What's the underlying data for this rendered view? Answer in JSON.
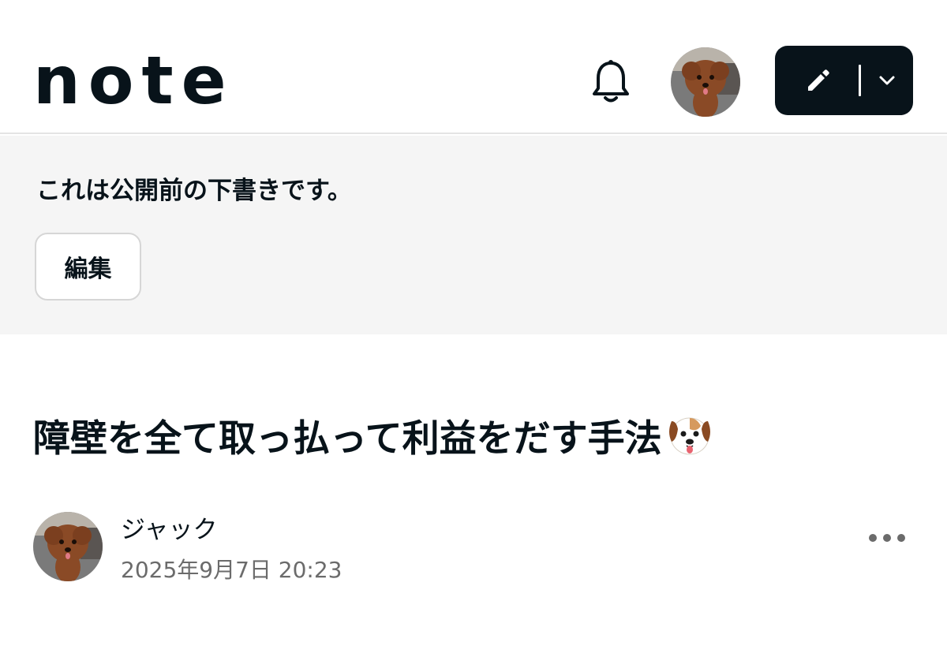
{
  "header": {
    "logo_text": "note",
    "bell_icon": "bell-icon",
    "avatar_icon": "dog-avatar",
    "post_button": {
      "pen_icon": "pen-icon",
      "dropdown_icon": "chevron-down-icon"
    }
  },
  "draft_banner": {
    "message": "これは公開前の下書きです。",
    "edit_label": "編集"
  },
  "article": {
    "title": "障壁を全て取っ払って利益をだす手法",
    "title_emoji": "dog-face-icon",
    "author_name": "ジャック",
    "date": "2025年9月7日 20:23",
    "more_icon": "more-dots-icon"
  },
  "colors": {
    "text": "#08131a",
    "banner_bg": "#f5f5f5",
    "muted": "#6b6b6b",
    "button_dark": "#08131a"
  }
}
